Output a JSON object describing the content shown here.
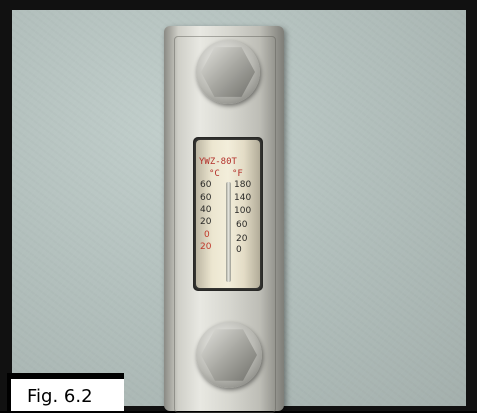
{
  "gauge": {
    "model_label": "YWZ-80T",
    "units": {
      "celsius": "°C",
      "fahrenheit": "°F"
    },
    "celsius_ticks": [
      "60",
      "60",
      "40",
      "20",
      "0",
      "20"
    ],
    "fahrenheit_ticks": [
      "180",
      "140",
      "100",
      "60",
      "20",
      "0"
    ]
  },
  "caption": {
    "text": "Fig. 6.2"
  },
  "colors": {
    "wall": "#b3c0bd",
    "label_red": "#b3302a",
    "plate_steel": "#d6d6cf"
  }
}
